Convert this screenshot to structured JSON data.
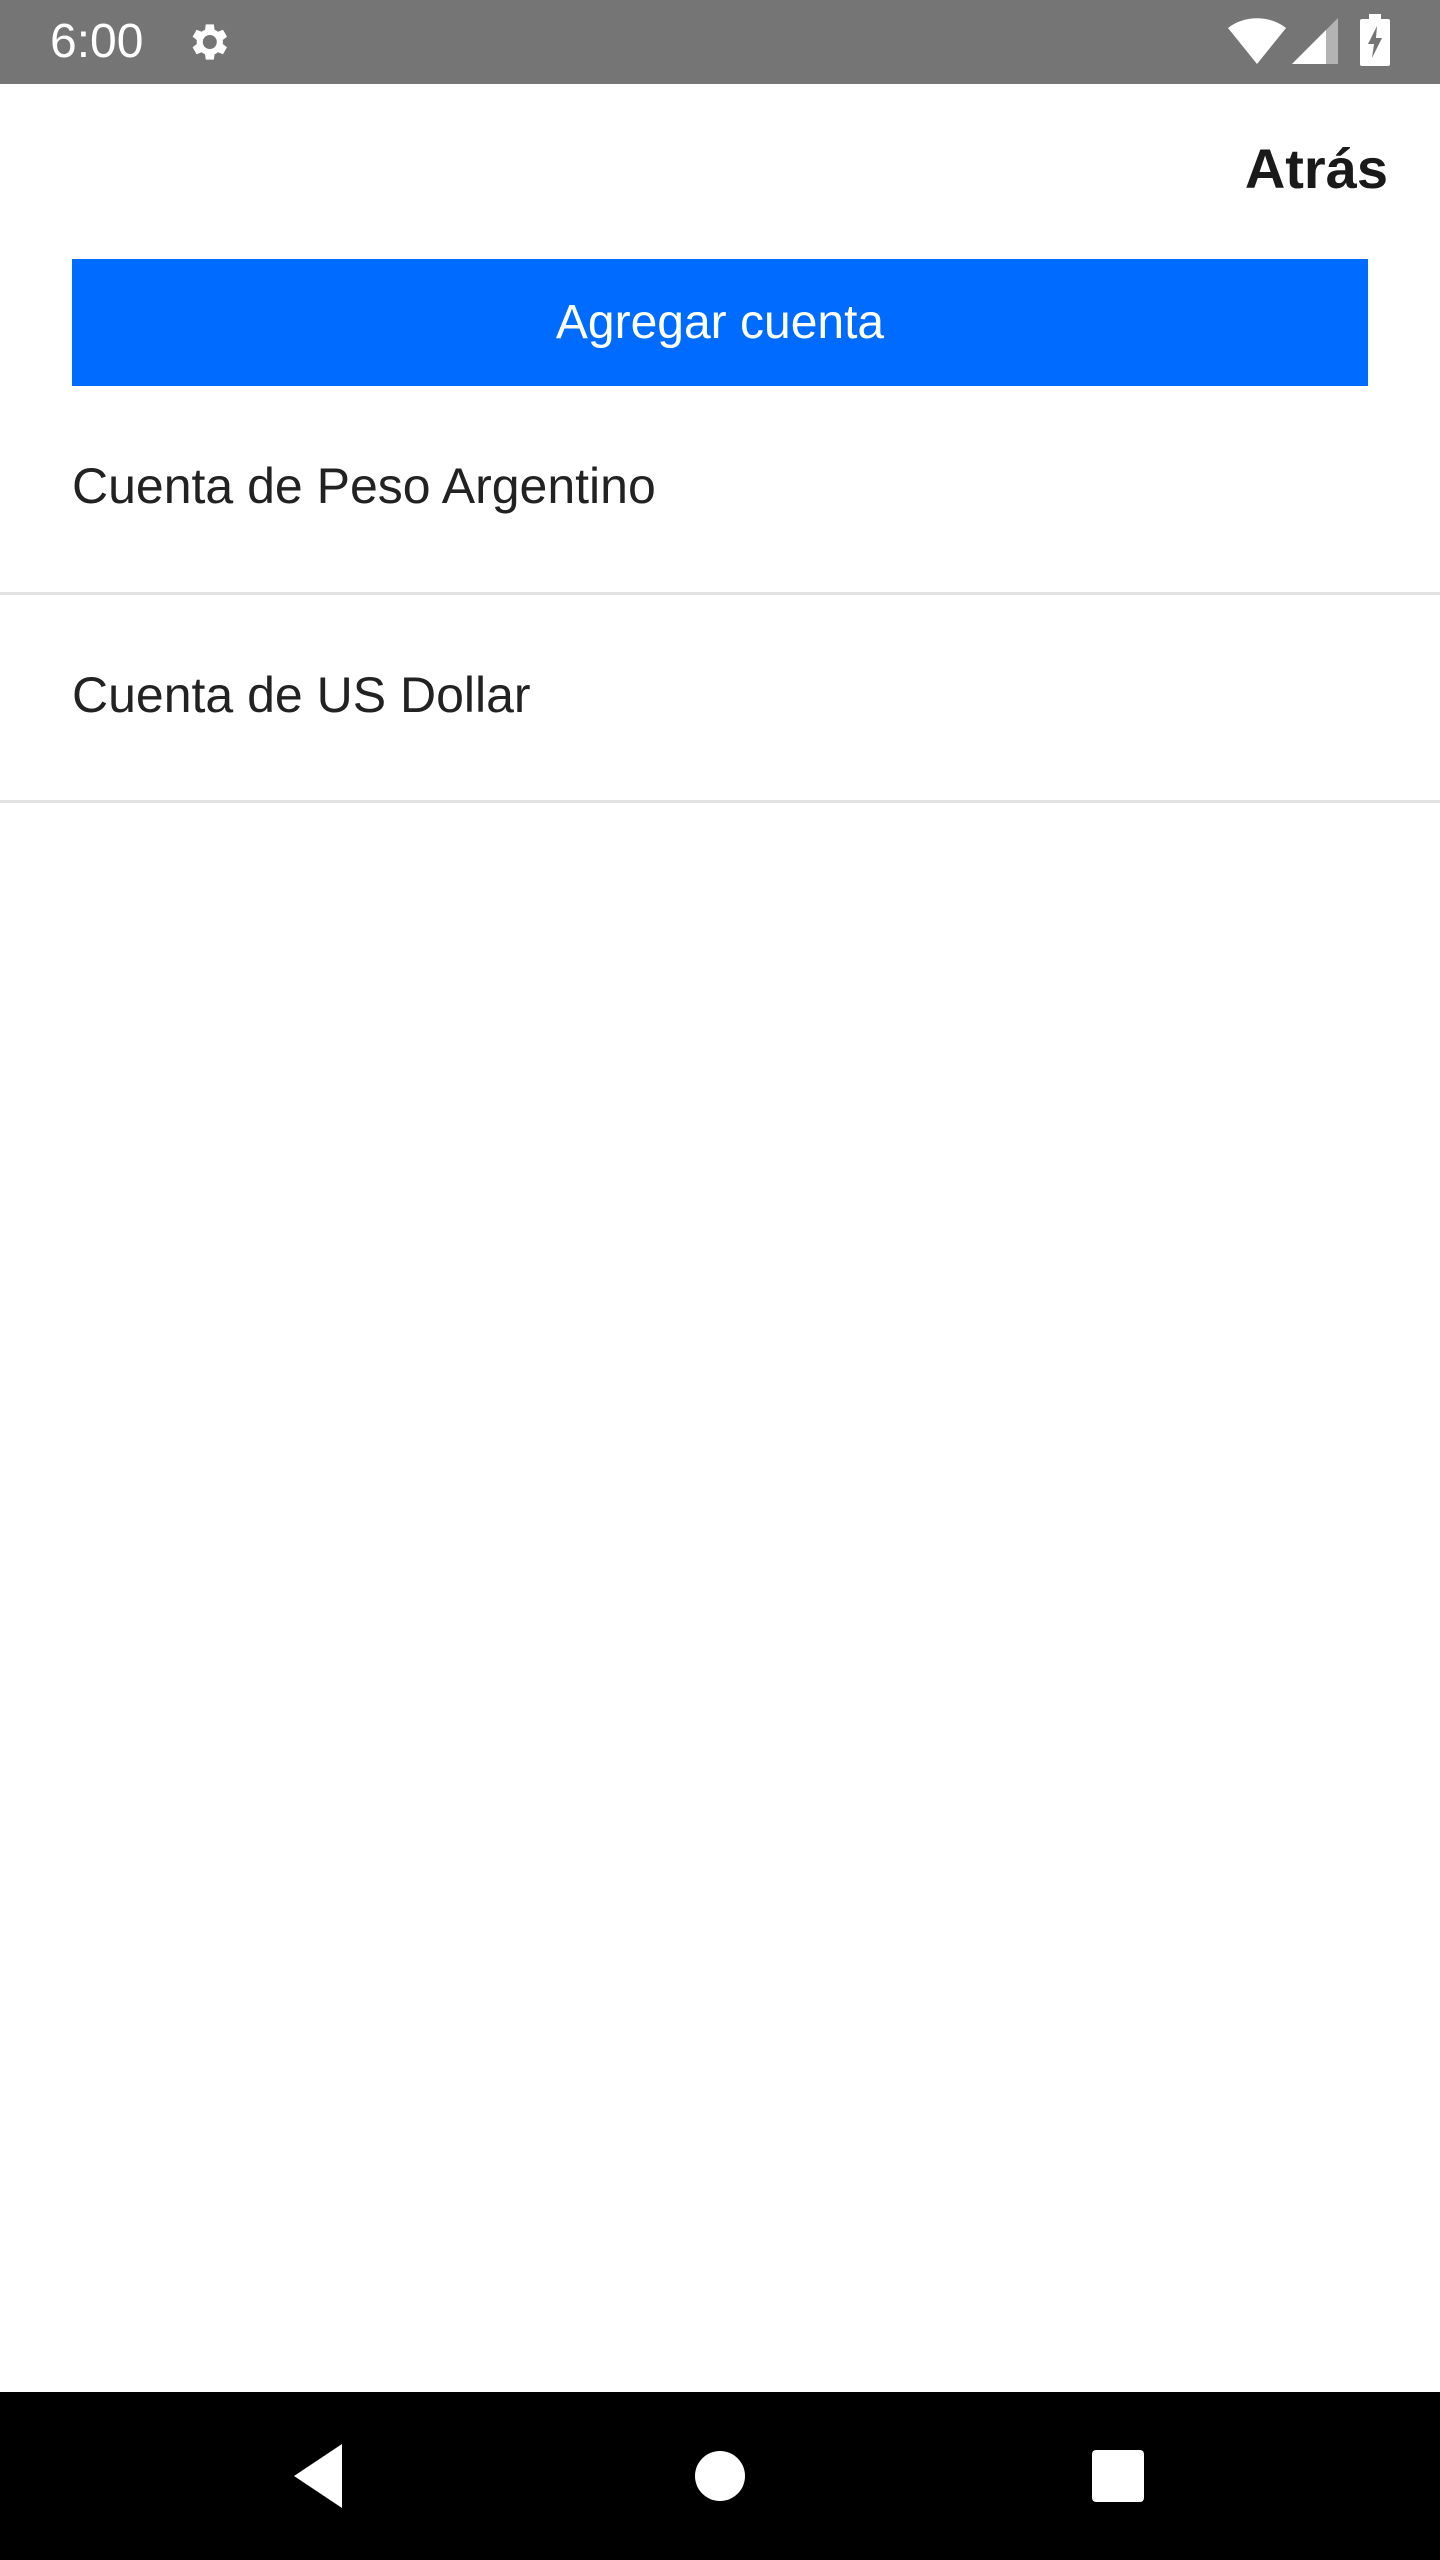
{
  "status_bar": {
    "time": "6:00",
    "icons": [
      "gear-icon",
      "wifi-icon",
      "signal-icon",
      "battery-icon"
    ],
    "background": "#757575"
  },
  "header": {
    "back_label": "Atrás"
  },
  "add_account": {
    "label": "Agregar cuenta",
    "color": "#006cff"
  },
  "accounts": [
    {
      "label": "Cuenta de Peso Argentino"
    },
    {
      "label": "Cuenta de US Dollar"
    }
  ],
  "nav_bar": {
    "icons": [
      "back-triangle-icon",
      "home-circle-icon",
      "recents-square-icon"
    ]
  }
}
